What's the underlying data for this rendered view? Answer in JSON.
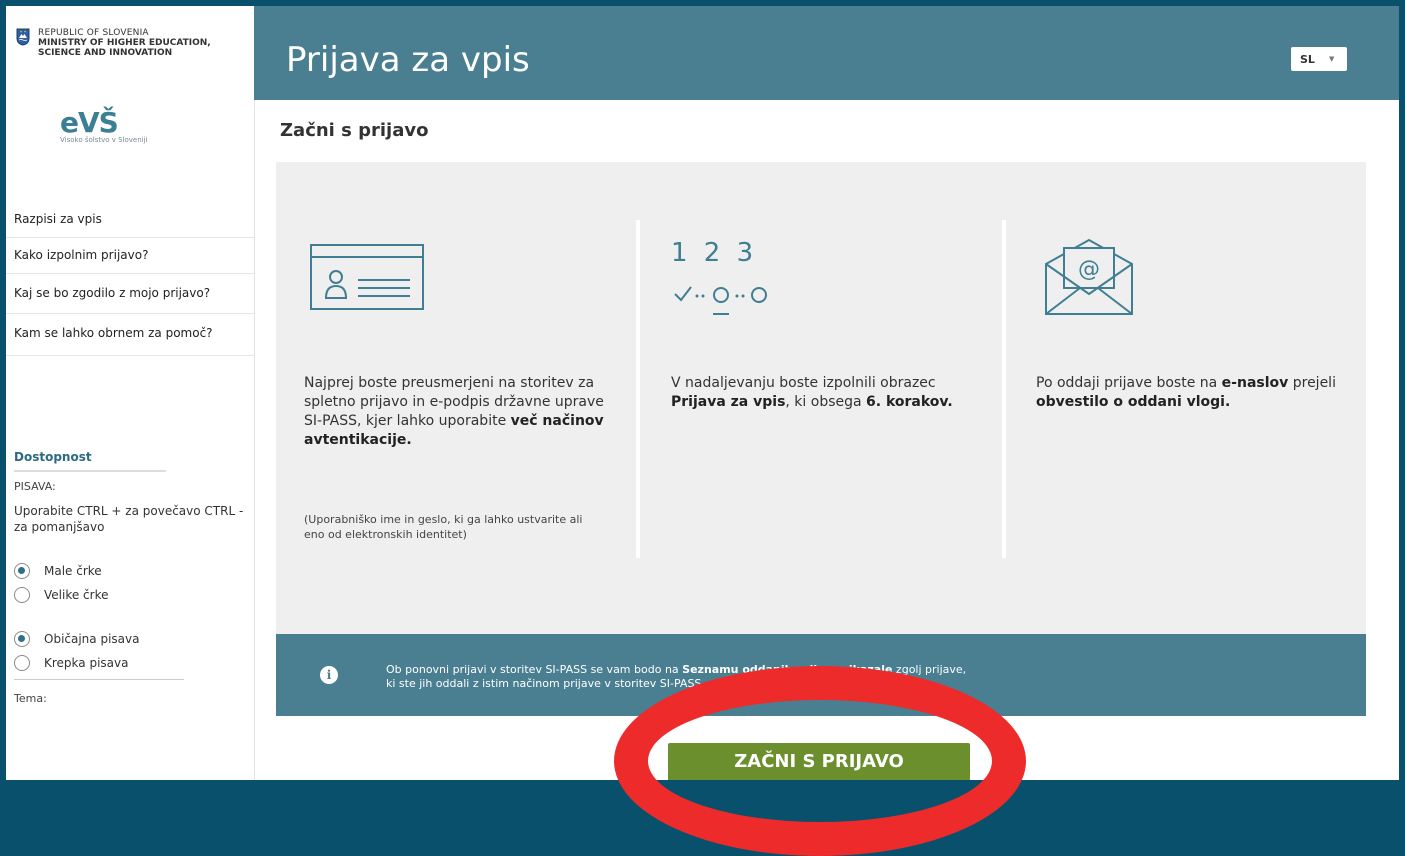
{
  "sidebar": {
    "ministry": {
      "line1": "REPUBLIC OF SLOVENIA",
      "line2": "MINISTRY OF HIGHER EDUCATION,",
      "line3": "SCIENCE AND INNOVATION"
    },
    "logo": {
      "title": "eVŠ",
      "subtitle": "Visoko šolstvo v Sloveniji"
    },
    "menu": [
      {
        "label": "Razpisi za vpis"
      },
      {
        "label": "Kako izpolnim prijavo?"
      },
      {
        "label": "Kaj se bo zgodilo z mojo prijavo?"
      },
      {
        "label": "Kam se lahko obrnem za pomoč?"
      }
    ],
    "accessibility": {
      "title": "Dostopnost",
      "font_label": "PISAVA:",
      "help_text": "Uporabite CTRL + za povečavo CTRL - za pomanjšavo",
      "size_options": [
        {
          "label": "Male črke",
          "checked": true
        },
        {
          "label": "Velike črke",
          "checked": false
        }
      ],
      "weight_options": [
        {
          "label": "Običajna pisava",
          "checked": true
        },
        {
          "label": "Krepka pisava",
          "checked": false
        }
      ],
      "theme_label": "Tema:"
    }
  },
  "header": {
    "title": "Prijava za vpis",
    "language": "SL"
  },
  "main": {
    "subtitle": "Začni s prijavo",
    "columns": [
      {
        "icon": "id-card-icon",
        "text_a": "Najprej boste preusmerjeni na storitev za spletno prijavo in e-podpis državne uprave SI-PASS, kjer lahko uporabite ",
        "text_bold": "več načinov avtentikacije.",
        "note": "(Uporabniško ime in geslo, ki ga lahko ustvarite ali eno od elektronskih identitet)"
      },
      {
        "icon": "steps-icon",
        "step_numbers": "1 2 3",
        "text_a": "V nadaljevanju boste izpolnili obrazec ",
        "text_bold1": "Prijava za vpis",
        "text_b": ", ki obsega ",
        "text_bold2": "6. korakov."
      },
      {
        "icon": "envelope-icon",
        "text_a": "Po oddaji prijave boste na ",
        "text_bold1": "e-naslov",
        "text_b": " prejeli ",
        "text_bold2": "obvestilo o oddani vlogi."
      }
    ],
    "info": {
      "icon": "info-icon",
      "line1_a": "Ob ponovni prijavi v storitev SI-PASS se vam bodo na ",
      "line1_bold": "Seznamu oddanih prijav prikazale",
      "line1_b": " zgolj prijave,",
      "line2": "ki ste jih oddali z istim načinom prijave v storitev SI-PASS."
    },
    "cta_label": "ZAČNI S PRIJAVO"
  },
  "colors": {
    "header_bg": "#4a7f92",
    "outer_frame": "#08506b",
    "cta_bg": "#6b8f2c",
    "highlight": "#ee2b2b"
  }
}
